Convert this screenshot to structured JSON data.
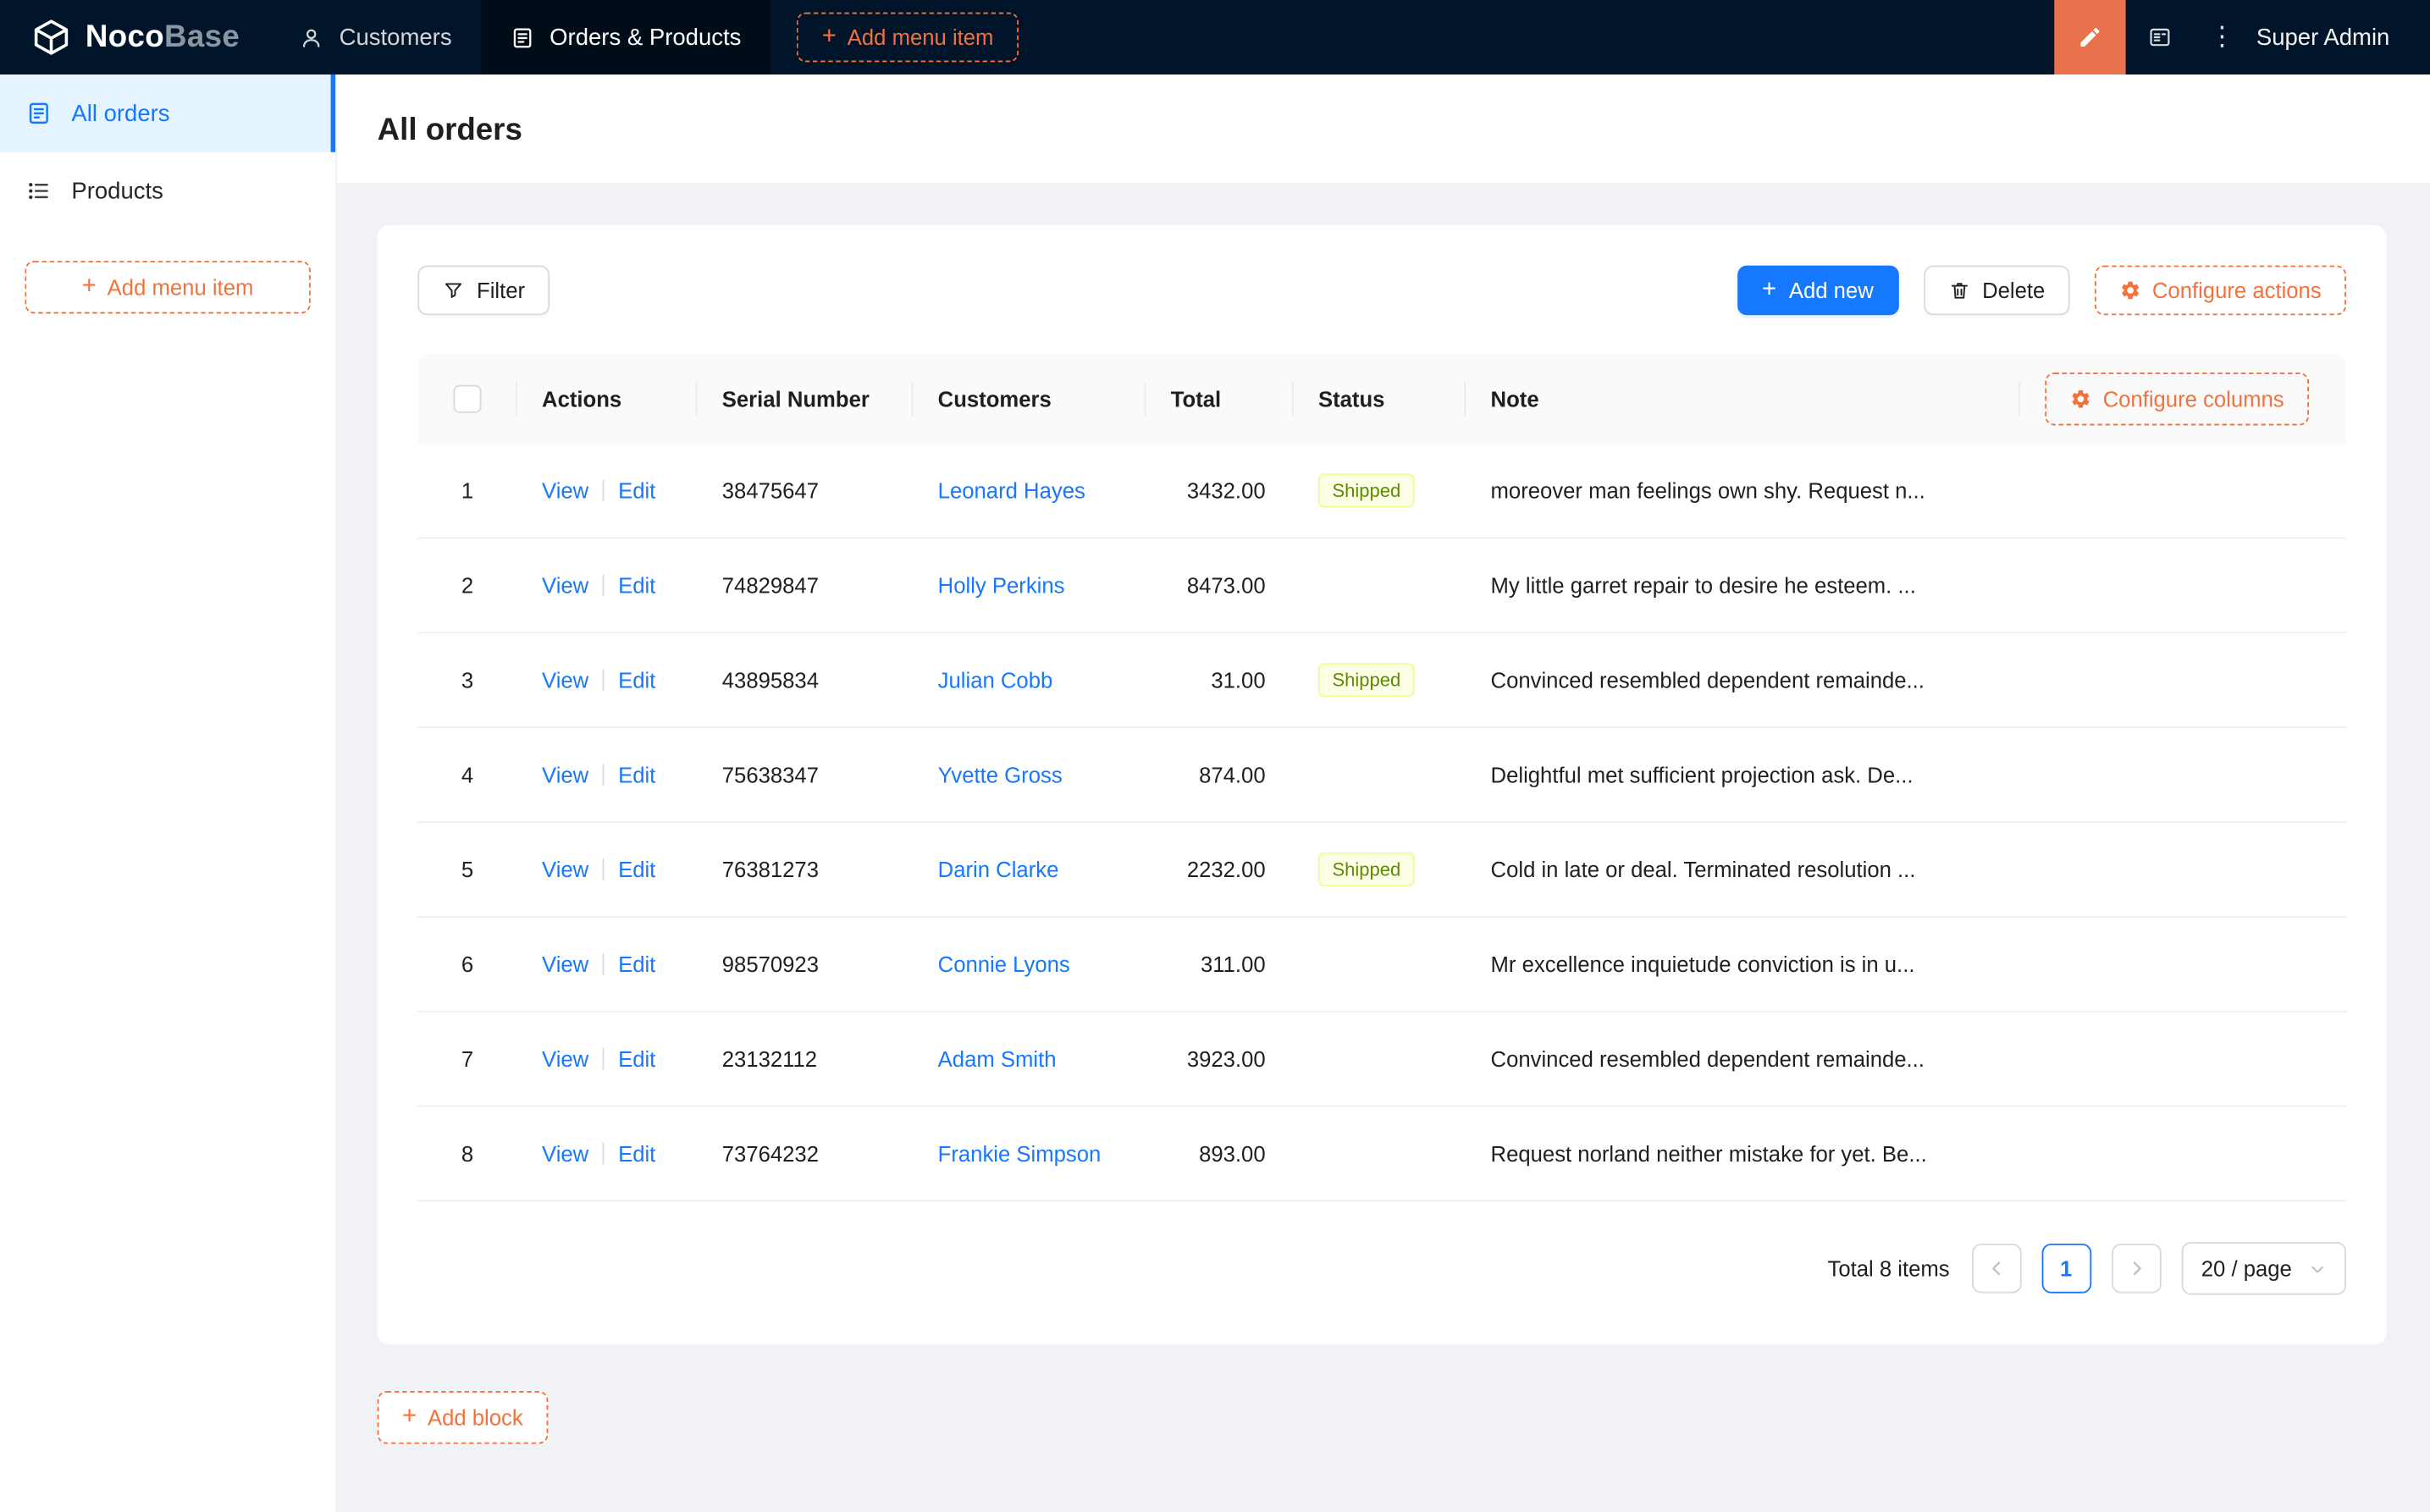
{
  "colors": {
    "navbar_bg": "#001529",
    "accent_blue": "#1677ff",
    "accent_orange": "#f2713c",
    "designer_button_bg": "#e8724c",
    "sidebar_active_bg": "#e6f4ff",
    "content_bg": "#f0f2f5",
    "tag_shipped_bg": "#fcffe6",
    "tag_shipped_border": "#eaff8f"
  },
  "icons": {
    "plus": "+",
    "more": "⋮"
  },
  "navbar": {
    "logo_bold": "Noco",
    "logo_light": "Base",
    "items": [
      {
        "label": "Customers"
      },
      {
        "label": "Orders & Products"
      }
    ],
    "add_menu_item_label": "Add menu item",
    "user_name": "Super Admin"
  },
  "sidebar": {
    "items": [
      {
        "label": "All orders"
      },
      {
        "label": "Products"
      }
    ],
    "add_menu_item_label": "Add menu item"
  },
  "page": {
    "title": "All orders",
    "add_block_label": "Add block"
  },
  "toolbar": {
    "filter_label": "Filter",
    "add_new_label": "Add new",
    "delete_label": "Delete",
    "configure_actions_label": "Configure actions"
  },
  "table": {
    "configure_columns_label": "Configure columns",
    "columns": [
      "Actions",
      "Serial Number",
      "Customers",
      "Total",
      "Status",
      "Note"
    ],
    "actions": {
      "view": "View",
      "edit": "Edit"
    },
    "rows": [
      {
        "index": 1,
        "serial": "38475647",
        "customer": "Leonard Hayes",
        "total": "3432.00",
        "status": "Shipped",
        "note": "moreover man feelings own shy. Request n..."
      },
      {
        "index": 2,
        "serial": "74829847",
        "customer": "Holly Perkins",
        "total": "8473.00",
        "status": "",
        "note": "My little garret repair to desire he esteem. ..."
      },
      {
        "index": 3,
        "serial": "43895834",
        "customer": "Julian Cobb",
        "total": "31.00",
        "status": "Shipped",
        "note": "Convinced resembled dependent remainde..."
      },
      {
        "index": 4,
        "serial": "75638347",
        "customer": "Yvette Gross",
        "total": "874.00",
        "status": "",
        "note": "Delightful met sufficient projection ask. De..."
      },
      {
        "index": 5,
        "serial": "76381273",
        "customer": "Darin Clarke",
        "total": "2232.00",
        "status": "Shipped",
        "note": "Cold in late or deal. Terminated resolution ..."
      },
      {
        "index": 6,
        "serial": "98570923",
        "customer": "Connie Lyons",
        "total": "311.00",
        "status": "",
        "note": "Mr excellence inquietude conviction is in u..."
      },
      {
        "index": 7,
        "serial": "23132112",
        "customer": "Adam Smith",
        "total": "3923.00",
        "status": "",
        "note": "Convinced resembled dependent remainde..."
      },
      {
        "index": 8,
        "serial": "73764232",
        "customer": "Frankie Simpson",
        "total": "893.00",
        "status": "",
        "note": "Request norland neither mistake for yet. Be..."
      }
    ]
  },
  "pagination": {
    "total_label": "Total 8 items",
    "current_page": "1",
    "page_size_label": "20 / page"
  }
}
